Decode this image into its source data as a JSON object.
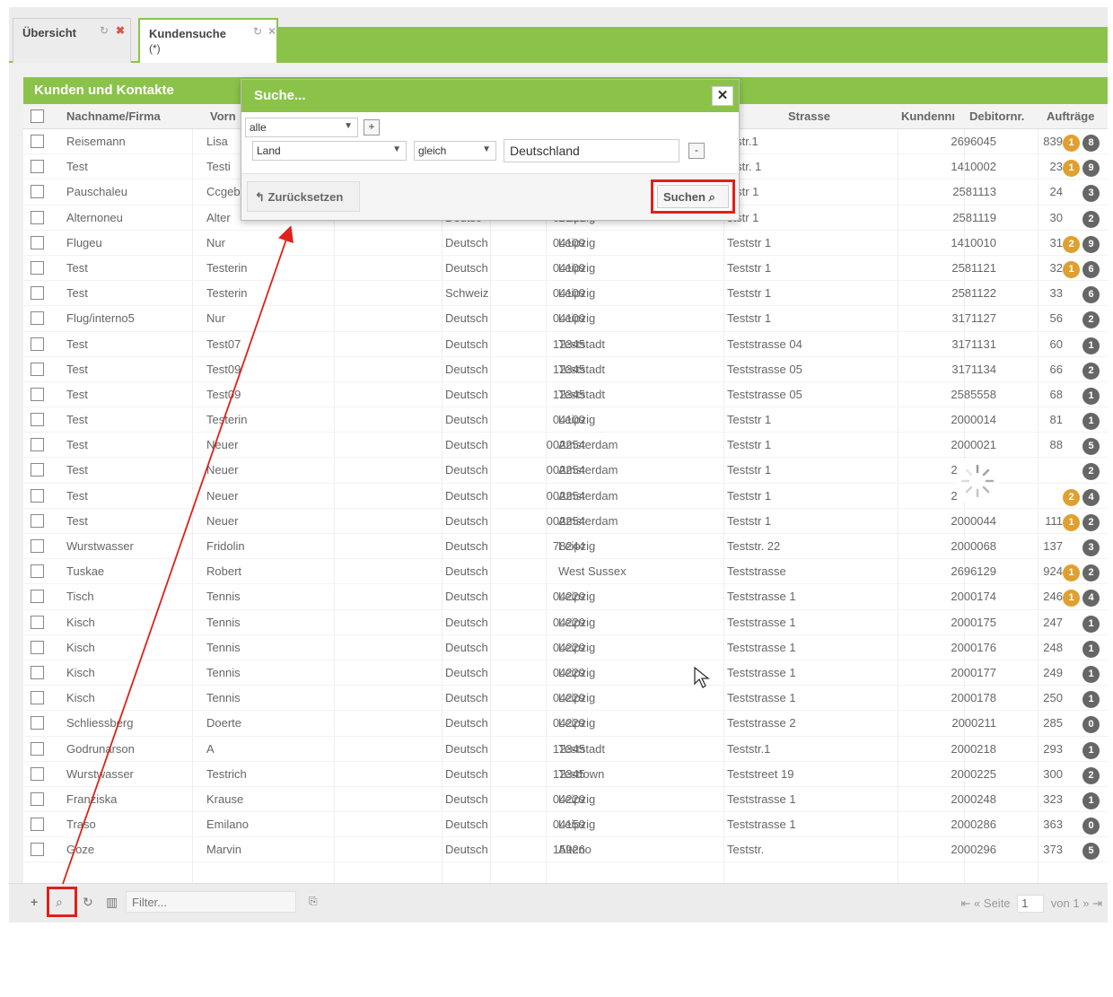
{
  "tabs": [
    {
      "label": "Übersicht",
      "sub": ""
    },
    {
      "label": "Kundensuche",
      "sub": "(*)"
    }
  ],
  "panel": {
    "title": "Kunden und Kontakte"
  },
  "columns": {
    "name": "Nachname/Firma",
    "vorname": "Vorn",
    "strasse": "Strasse",
    "kundennr": "Kundennı",
    "debitornr": "Debitornr.",
    "auftraege": "Aufträge"
  },
  "rows": [
    {
      "name": "Reisemann",
      "vorname": "Lisa",
      "land": "",
      "plz": "",
      "ort": "",
      "strasse": "ststr.1",
      "kdnr": "839",
      "debnr": "2696045",
      "b1": "1",
      "b2": "8"
    },
    {
      "name": "Test",
      "vorname": "Testi",
      "land": "",
      "plz": "",
      "ort": "",
      "strasse": "ststr. 1",
      "kdnr": "23",
      "debnr": "1410002",
      "b1": "1",
      "b2": "9"
    },
    {
      "name": "Pauschaleu",
      "vorname": "Ccgebu",
      "land": "",
      "plz": "",
      "ort": "",
      "strasse": "ststr 1",
      "kdnr": "24",
      "debnr": "2581113",
      "b1": "",
      "b2": "3"
    },
    {
      "name": "Alternoneu",
      "vorname": "Alter",
      "land": "Deutsc",
      "plz": "04109",
      "ort": "Leipzig",
      "strasse": "ststr 1",
      "kdnr": "30",
      "debnr": "2581119",
      "b1": "",
      "b2": "2"
    },
    {
      "name": "Flugeu",
      "vorname": "Nur",
      "land": "Deutsch",
      "plz": "04109",
      "ort": "Leipzig",
      "strasse": "Teststr 1",
      "kdnr": "31",
      "debnr": "1410010",
      "b1": "2",
      "b2": "9"
    },
    {
      "name": "Test",
      "vorname": "Testerin",
      "land": "Deutsch",
      "plz": "04109",
      "ort": "Leipzig",
      "strasse": "Teststr 1",
      "kdnr": "32",
      "debnr": "2581121",
      "b1": "1",
      "b2": "6"
    },
    {
      "name": "Test",
      "vorname": "Testerin",
      "land": "Schweiz",
      "plz": "04109",
      "ort": "Leipzig",
      "strasse": "Teststr 1",
      "kdnr": "33",
      "debnr": "2581122",
      "b1": "",
      "b2": "6"
    },
    {
      "name": "Flug/interno5",
      "vorname": "Nur",
      "land": "Deutsch",
      "plz": "04109",
      "ort": "Leipzig",
      "strasse": "Teststr 1",
      "kdnr": "56",
      "debnr": "3171127",
      "b1": "",
      "b2": "2"
    },
    {
      "name": "Test",
      "vorname": "Test07",
      "land": "Deutsch",
      "plz": "12345",
      "ort": "Teststadt",
      "strasse": "Teststrasse 04",
      "kdnr": "60",
      "debnr": "3171131",
      "b1": "",
      "b2": "1"
    },
    {
      "name": "Test",
      "vorname": "Test09",
      "land": "Deutsch",
      "plz": "12345",
      "ort": "Teststadt",
      "strasse": "Teststrasse 05",
      "kdnr": "66",
      "debnr": "3171134",
      "b1": "",
      "b2": "2"
    },
    {
      "name": "Test",
      "vorname": "Test09",
      "land": "Deutsch",
      "plz": "12345",
      "ort": "Teststadt",
      "strasse": "Teststrasse 05",
      "kdnr": "68",
      "debnr": "2585558",
      "b1": "",
      "b2": "1"
    },
    {
      "name": "Test",
      "vorname": "Testerin",
      "land": "Deutsch",
      "plz": "04109",
      "ort": "Leipzig",
      "strasse": "Teststr 1",
      "kdnr": "81",
      "debnr": "2000014",
      "b1": "",
      "b2": "1"
    },
    {
      "name": "Test",
      "vorname": "Neuer",
      "land": "Deutsch",
      "plz": "002254",
      "ort": "Amsterdam",
      "strasse": "Teststr 1",
      "kdnr": "88",
      "debnr": "2000021",
      "b1": "",
      "b2": "5"
    },
    {
      "name": "Test",
      "vorname": "Neuer",
      "land": "Deutsch",
      "plz": "002254",
      "ort": "Amsterdam",
      "strasse": "Teststr 1",
      "kdnr": "",
      "debnr": "2000022",
      "b1": "",
      "b2": "2"
    },
    {
      "name": "Test",
      "vorname": "Neuer",
      "land": "Deutsch",
      "plz": "002254",
      "ort": "Amsterdam",
      "strasse": "Teststr 1",
      "kdnr": "",
      "debnr": "2000024",
      "b1": "2",
      "b2": "4"
    },
    {
      "name": "Test",
      "vorname": "Neuer",
      "land": "Deutsch",
      "plz": "002254",
      "ort": "Amsterdam",
      "strasse": "Teststr 1",
      "kdnr": "111",
      "debnr": "2000044",
      "b1": "1",
      "b2": "2"
    },
    {
      "name": "Wurstwasser",
      "vorname": "Fridolin",
      "land": "Deutsch",
      "plz": "78244",
      "ort": "Leipzig",
      "strasse": "Teststr. 22",
      "kdnr": "137",
      "debnr": "2000068",
      "b1": "",
      "b2": "3"
    },
    {
      "name": "Tuskae",
      "vorname": "Robert",
      "land": "Deutsch",
      "plz": "",
      "ort": "West Sussex",
      "strasse": "Teststrasse",
      "kdnr": "924",
      "debnr": "2696129",
      "b1": "1",
      "b2": "2"
    },
    {
      "name": "Tisch",
      "vorname": "Tennis",
      "land": "Deutsch",
      "plz": "04229",
      "ort": "Leipzig",
      "strasse": "Teststrasse 1",
      "kdnr": "246",
      "debnr": "2000174",
      "b1": "1",
      "b2": "4"
    },
    {
      "name": "Kisch",
      "vorname": "Tennis",
      "land": "Deutsch",
      "plz": "04229",
      "ort": "Leipzig",
      "strasse": "Teststrasse 1",
      "kdnr": "247",
      "debnr": "2000175",
      "b1": "",
      "b2": "1"
    },
    {
      "name": "Kisch",
      "vorname": "Tennis",
      "land": "Deutsch",
      "plz": "04229",
      "ort": "Leipzig",
      "strasse": "Teststrasse 1",
      "kdnr": "248",
      "debnr": "2000176",
      "b1": "",
      "b2": "1"
    },
    {
      "name": "Kisch",
      "vorname": "Tennis",
      "land": "Deutsch",
      "plz": "04229",
      "ort": "Leipzig",
      "strasse": "Teststrasse 1",
      "kdnr": "249",
      "debnr": "2000177",
      "b1": "",
      "b2": "1"
    },
    {
      "name": "Kisch",
      "vorname": "Tennis",
      "land": "Deutsch",
      "plz": "04229",
      "ort": "Leipzig",
      "strasse": "Teststrasse 1",
      "kdnr": "250",
      "debnr": "2000178",
      "b1": "",
      "b2": "1"
    },
    {
      "name": "Schliessberg",
      "vorname": "Doerte",
      "land": "Deutsch",
      "plz": "04229",
      "ort": "Leipzig",
      "strasse": "Teststrasse 2",
      "kdnr": "285",
      "debnr": "2000211",
      "b1": "",
      "b2": "0"
    },
    {
      "name": "Godrunarson",
      "vorname": "A",
      "land": "Deutsch",
      "plz": "12345",
      "ort": "Teststadt",
      "strasse": "Teststr.1",
      "kdnr": "293",
      "debnr": "2000218",
      "b1": "",
      "b2": "1"
    },
    {
      "name": "Wurstwasser",
      "vorname": "Testrich",
      "land": "Deutsch",
      "plz": "12345",
      "ort": "Testtown",
      "strasse": "Teststreet 19",
      "kdnr": "300",
      "debnr": "2000225",
      "b1": "",
      "b2": "2"
    },
    {
      "name": "Franziska",
      "vorname": "Krause",
      "land": "Deutsch",
      "plz": "04229",
      "ort": "Leipzig",
      "strasse": "Teststrasse 1",
      "kdnr": "323",
      "debnr": "2000248",
      "b1": "",
      "b2": "1"
    },
    {
      "name": "Traso",
      "vorname": "Emilano",
      "land": "Deutsch",
      "plz": "04159",
      "ort": "Leipzig",
      "strasse": "Teststrasse 1",
      "kdnr": "363",
      "debnr": "2000286",
      "b1": "",
      "b2": "0"
    },
    {
      "name": "Goze",
      "vorname": "Marvin",
      "land": "Deutsch",
      "plz": "15926",
      "ort": "Alteno",
      "strasse": "Teststr.",
      "kdnr": "373",
      "debnr": "2000296",
      "b1": "",
      "b2": "5"
    }
  ],
  "toolbar": {
    "filter_placeholder": "Filter...",
    "page_label": "Seite",
    "page_value": "1",
    "of_label": "von 1"
  },
  "popup": {
    "title": "Suche...",
    "combinator": "alle",
    "field": "Land",
    "operator": "gleich",
    "value": "Deutschland",
    "reset_label": "Zurücksetzen",
    "search_label": "Suchen"
  },
  "colors": {
    "accent": "#8bc34a",
    "highlight": "#e0201a",
    "badge_orange": "#e0a030",
    "badge_grey": "#666666"
  }
}
